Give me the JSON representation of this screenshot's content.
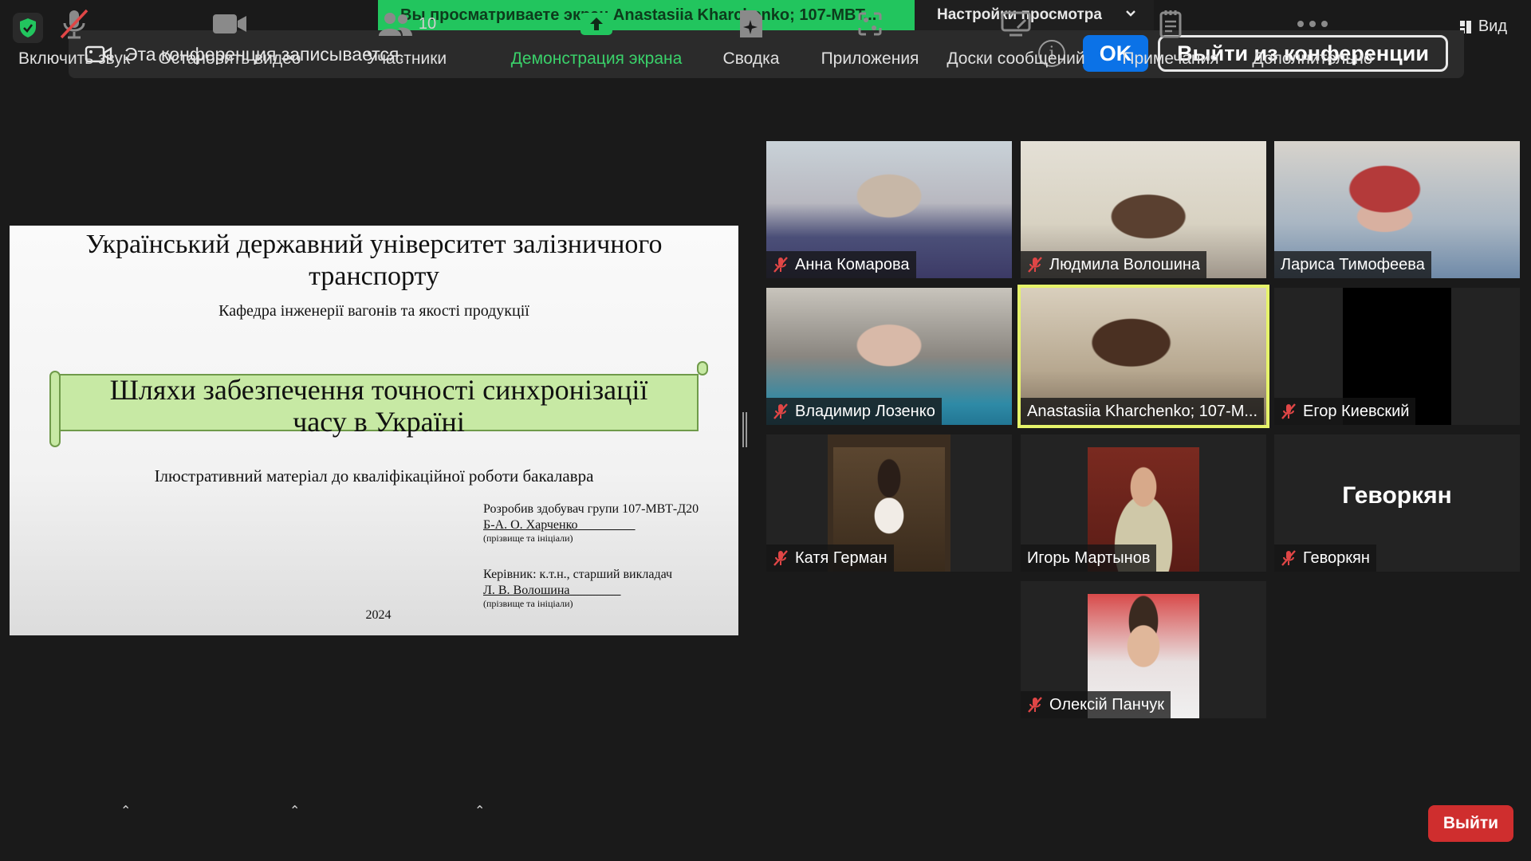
{
  "banner": {
    "sharing_text": "Вы просматриваете экран Anastasiia Kharchenko; 107-МВТ...",
    "view_settings_label": "Настройки просмотра",
    "view_label": "Вид"
  },
  "recording": {
    "message": "Эта конференция записывается.",
    "ok_label": "OK",
    "leave_conference_label": "Выйти из конференции"
  },
  "slide": {
    "university_line1": "Український державний університет залізничного",
    "university_line2": "транспорту",
    "department": "Кафедра інженерії вагонів та якості продукції",
    "title_line1": "Шляхи забезпечення точності синхронізації",
    "title_line2": "часу в Україні",
    "illustrative": "Ілюстративний матеріал до кваліфікаційної роботи бакалавра",
    "author_line": "Розробив здобувач групи 107-МВТ-Д20",
    "author_name": "Б-А. О. Харченко",
    "author_hint": "(прізвище та ініціали)",
    "supervisor_line": "Керівник: к.т.н., старший викладач",
    "supervisor_name": "Л. В. Волошина",
    "supervisor_hint": "(прізвище та ініціали)",
    "year": "2024"
  },
  "participants": [
    {
      "name": "Анна Комарова",
      "muted": true
    },
    {
      "name": "Людмила Волошина",
      "muted": true
    },
    {
      "name": "Лариса Тимофеева",
      "muted": false
    },
    {
      "name": "Владимир Лозенко",
      "muted": true
    },
    {
      "name": "Anastasiia Kharchenko; 107-М...",
      "muted": false,
      "active": true
    },
    {
      "name": "Егор Киевский",
      "muted": true
    },
    {
      "name": "Катя Герман",
      "muted": true
    },
    {
      "name": "Игорь Мартынов",
      "muted": false
    },
    {
      "name": "Геворкян",
      "muted": true,
      "display_text": "Геворкян"
    },
    {
      "name": "Олексій Панчук",
      "muted": true
    }
  ],
  "toolbar": {
    "unmute_label": "Включить звук",
    "stop_video_label": "Остановить видео",
    "participants_label": "Участники",
    "participants_count": "10",
    "share_label": "Демонстрация экрана",
    "summary_label": "Сводка",
    "apps_label": "Приложения",
    "whiteboards_label": "Доски сообщений",
    "notes_label": "Примечания",
    "more_label": "Дополнительно",
    "leave_label": "Выйти"
  },
  "colors": {
    "share_banner": "#22c55e",
    "ok_button": "#0b72e7",
    "leave_button": "#cf2e2e",
    "active_speaker": "#e6f36a",
    "muted_icon": "#e04646"
  }
}
